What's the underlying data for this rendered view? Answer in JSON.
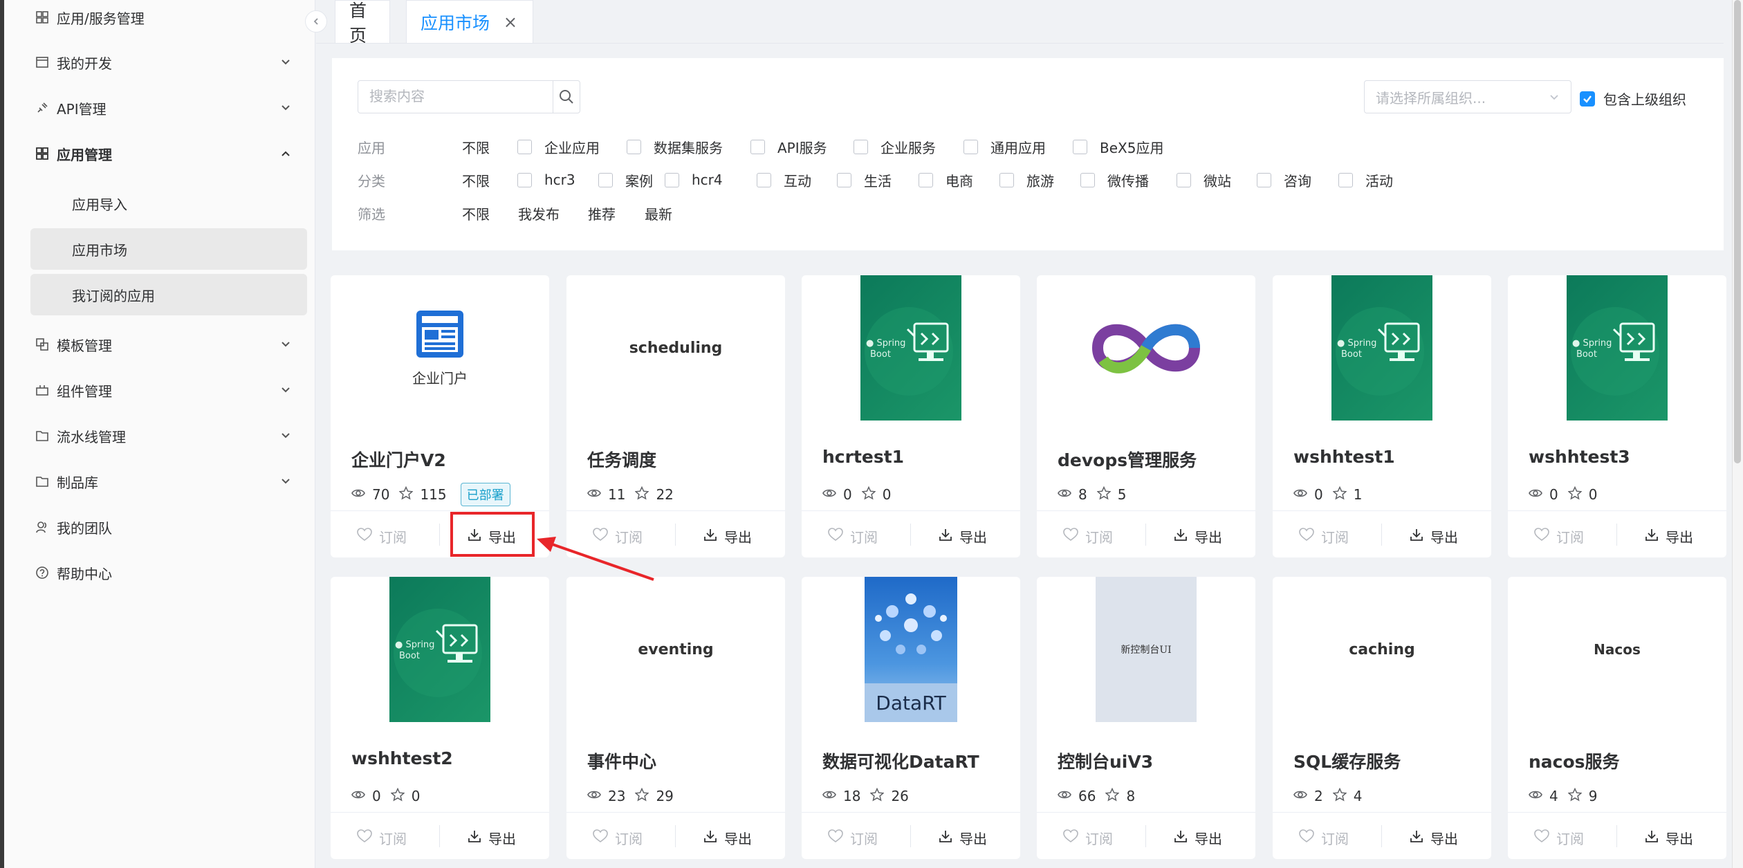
{
  "sidebar": {
    "items": [
      {
        "label": "应用/服务管理"
      },
      {
        "label": "我的开发"
      },
      {
        "label": "API管理"
      },
      {
        "label": "应用管理"
      },
      {
        "label": "模板管理"
      },
      {
        "label": "组件管理"
      },
      {
        "label": "流水线管理"
      },
      {
        "label": "制品库"
      },
      {
        "label": "我的团队"
      },
      {
        "label": "帮助中心"
      }
    ],
    "sub_items": [
      {
        "label": "应用导入"
      },
      {
        "label": "应用市场"
      },
      {
        "label": "我订阅的应用"
      }
    ]
  },
  "tabs": [
    {
      "label": "首页"
    },
    {
      "label": "应用市场",
      "close": "×"
    }
  ],
  "search": {
    "placeholder": "搜索内容"
  },
  "org_select": {
    "placeholder": "请选择所属组织..."
  },
  "include_parent": {
    "label": "包含上级组织",
    "checked": true
  },
  "filters": {
    "app": {
      "label": "应用",
      "options": [
        "不限",
        "企业应用",
        "数据集服务",
        "API服务",
        "企业服务",
        "通用应用",
        "BeX5应用"
      ]
    },
    "category": {
      "label": "分类",
      "options": [
        "不限",
        "hcr3",
        "案例",
        "hcr4",
        "互动",
        "生活",
        "电商",
        "旅游",
        "微传播",
        "微站",
        "咨询",
        "活动"
      ]
    },
    "screen": {
      "label": "筛选",
      "options": [
        "不限",
        "我发布",
        "推荐",
        "最新"
      ]
    }
  },
  "card_actions": {
    "subscribe": "订阅",
    "export": "导出"
  },
  "cards": [
    {
      "title": "企业门户V2",
      "views": "70",
      "stars": "115",
      "badge": "已部署",
      "logo_text": "企业门户"
    },
    {
      "title": "任务调度",
      "views": "11",
      "stars": "22",
      "logo_text": "scheduling"
    },
    {
      "title": "hcrtest1",
      "views": "0",
      "stars": "0"
    },
    {
      "title": "devops管理服务",
      "views": "8",
      "stars": "5"
    },
    {
      "title": "wshhtest1",
      "views": "0",
      "stars": "1"
    },
    {
      "title": "wshhtest3",
      "views": "0",
      "stars": "0"
    },
    {
      "title": "wshhtest2",
      "views": "0",
      "stars": "0"
    },
    {
      "title": "事件中心",
      "views": "23",
      "stars": "29",
      "logo_text": "eventing"
    },
    {
      "title": "数据可视化DataRT",
      "views": "18",
      "stars": "26",
      "logo_text": "DataRT"
    },
    {
      "title": "控制台uiV3",
      "views": "66",
      "stars": "8",
      "logo_text": "新控制台UI"
    },
    {
      "title": "SQL缓存服务",
      "views": "2",
      "stars": "4",
      "logo_text": "caching"
    },
    {
      "title": "nacos服务",
      "views": "4",
      "stars": "9",
      "logo_text": "Nacos"
    }
  ],
  "springboot_logo_text": "Spring Boot",
  "colors": {
    "accent": "#1890ff",
    "highlight": "#e8262a",
    "springboot_green": "#0c7a5a"
  }
}
